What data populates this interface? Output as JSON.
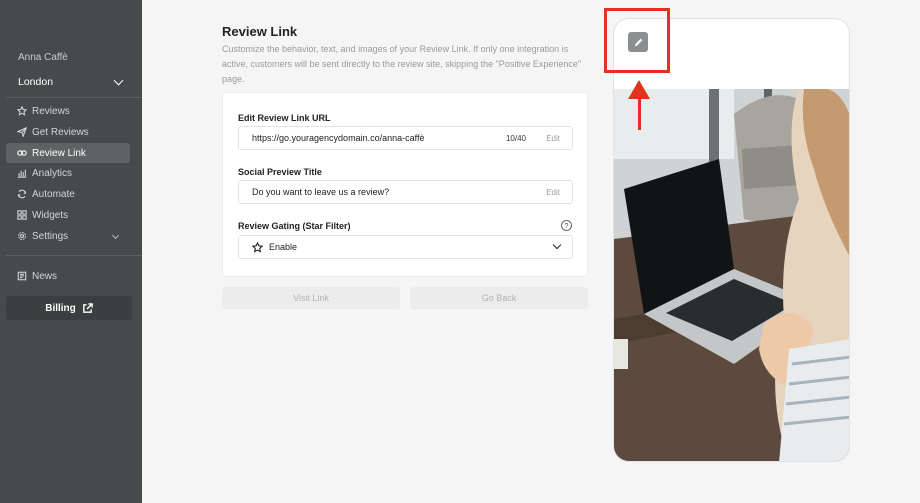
{
  "sidebar": {
    "business_name": "Anna Caffè",
    "location": "London",
    "items": [
      {
        "label": "Reviews",
        "icon": "star-icon"
      },
      {
        "label": "Get Reviews",
        "icon": "send-icon"
      },
      {
        "label": "Review Link",
        "icon": "link-icon"
      },
      {
        "label": "Analytics",
        "icon": "bar-chart-icon"
      },
      {
        "label": "Automate",
        "icon": "automate-icon"
      },
      {
        "label": "Widgets",
        "icon": "widgets-icon"
      },
      {
        "label": "Settings",
        "icon": "gear-icon"
      }
    ],
    "news_label": "News",
    "billing_label": "Billing"
  },
  "main": {
    "title": "Review Link",
    "description": "Customize the behavior, text, and images of your Review Link. If only one integration is active, customers will be sent directly to the review site, skipping the \"Positive Experience\" page.",
    "url_field": {
      "label": "Edit Review Link URL",
      "value": "https://go.youragencydomain.co/anna-caffè",
      "count": "10/40",
      "edit_label": "Edit"
    },
    "title_field": {
      "label": "Social Preview Title",
      "value": "Do you want to leave us a review?",
      "edit_label": "Edit"
    },
    "gating_field": {
      "label": "Review Gating (Star Filter)",
      "help_icon": "?",
      "selected": "Enable"
    },
    "visit_link_label": "Visit Link",
    "go_back_label": "Go Back"
  },
  "colors": {
    "sidebar_bg": "#464a4b",
    "highlight": "#e1341e",
    "edit_button_bg": "#8b8f90"
  }
}
